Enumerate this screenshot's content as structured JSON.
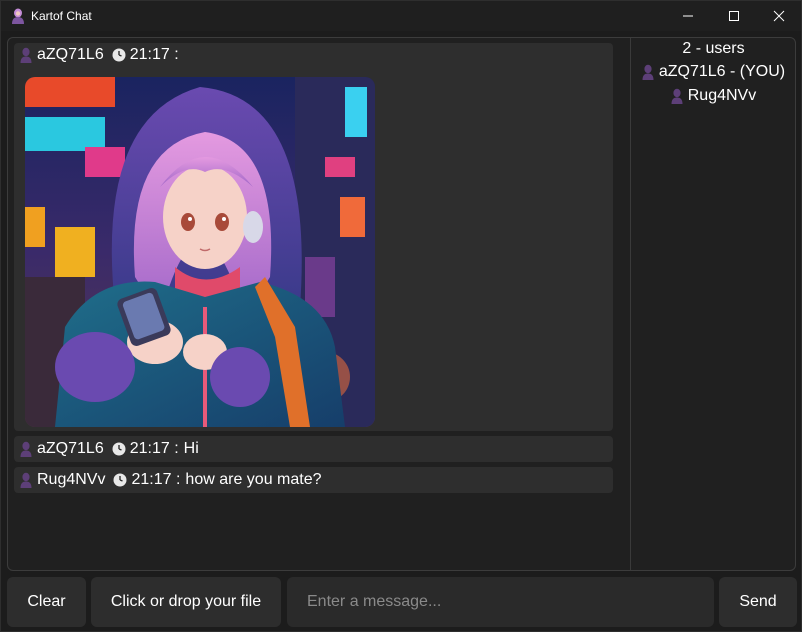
{
  "window": {
    "title": "Kartof Chat"
  },
  "messages": [
    {
      "user": "aZQ71L6",
      "time": "21:17 :",
      "text": "",
      "has_image": true
    },
    {
      "user": "aZQ71L6",
      "time": "21:17 :",
      "text": "Hi",
      "has_image": false
    },
    {
      "user": "Rug4NVv",
      "time": "21:17 :",
      "text": "how are you mate?",
      "has_image": false
    }
  ],
  "users": {
    "count_label": "2 - users",
    "list": [
      {
        "name": "aZQ71L6 - (YOU)"
      },
      {
        "name": "Rug4NVv"
      }
    ]
  },
  "bottom": {
    "clear_label": "Clear",
    "file_label": "Click or drop your file",
    "message_placeholder": "Enter a message...",
    "send_label": "Send"
  },
  "icons": {
    "user": "user-icon",
    "clock": "clock-icon"
  },
  "colors": {
    "background": "#1c1c1c",
    "message_bg": "#2e2e2e",
    "button_bg": "#2d2d2d",
    "user_icon": "#6b4a8a"
  }
}
